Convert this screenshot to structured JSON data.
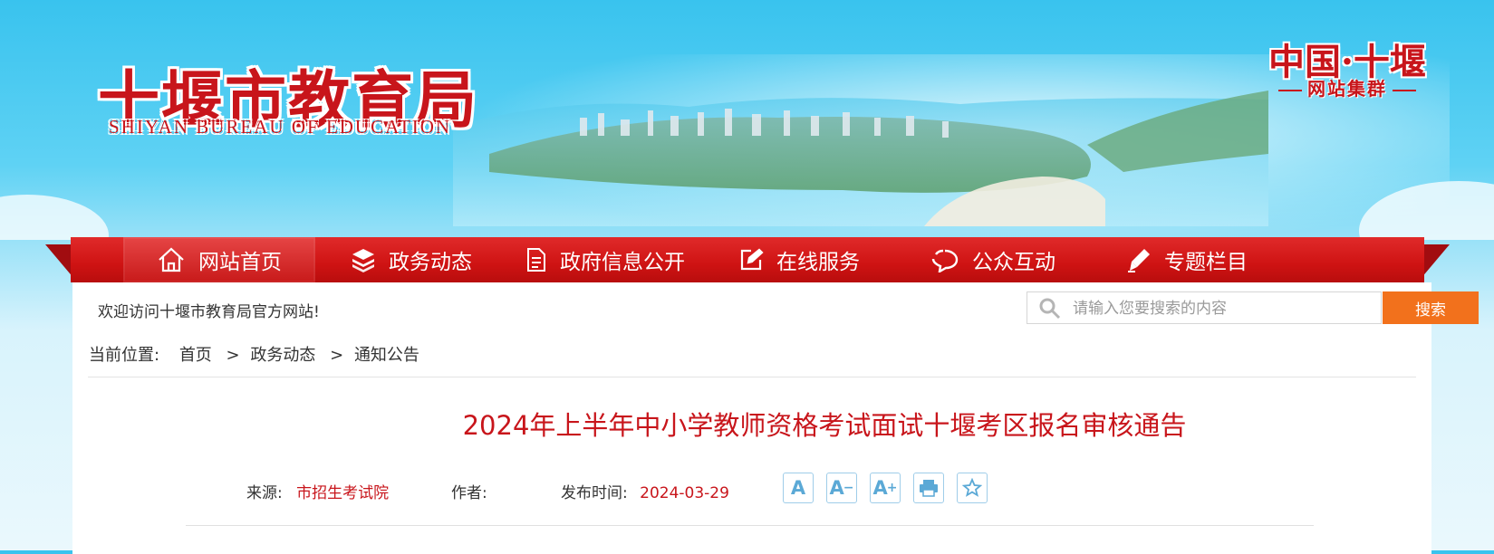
{
  "header": {
    "logo_cn": "十堰市教育局",
    "logo_en": "SHIYAN BUREAU OF EDUCATION",
    "corner_line1": "中国·十堰",
    "corner_line2": "网站集群"
  },
  "nav": {
    "items": [
      {
        "label": "网站首页",
        "icon": "home-icon"
      },
      {
        "label": "政务动态",
        "icon": "layers-icon"
      },
      {
        "label": "政府信息公开",
        "icon": "document-icon"
      },
      {
        "label": "在线服务",
        "icon": "edit-icon"
      },
      {
        "label": "公众互动",
        "icon": "chat-icon"
      },
      {
        "label": "专题栏目",
        "icon": "pen-icon"
      }
    ]
  },
  "toolbar": {
    "welcome": "欢迎访问十堰市教育局官方网站!",
    "search_placeholder": "请输入您要搜索的内容",
    "search_button": "搜索"
  },
  "breadcrumb": {
    "label": "当前位置:",
    "items": [
      "首页",
      "政务动态",
      "通知公告"
    ],
    "separator": ">"
  },
  "article": {
    "title": "2024年上半年中小学教师资格考试面试十堰考区报名审核通告",
    "source_label": "来源:",
    "source_value": "市招生考试院",
    "author_label": "作者:",
    "author_value": "",
    "date_label": "发布时间:",
    "date_value": "2024-03-29"
  },
  "tools": {
    "font_normal": "A",
    "font_smaller": "A",
    "font_larger": "A"
  },
  "colors": {
    "brand_red": "#c8151b",
    "nav_red": "#cf1313",
    "search_orange": "#f2711c",
    "sky_blue": "#39c3ee"
  }
}
